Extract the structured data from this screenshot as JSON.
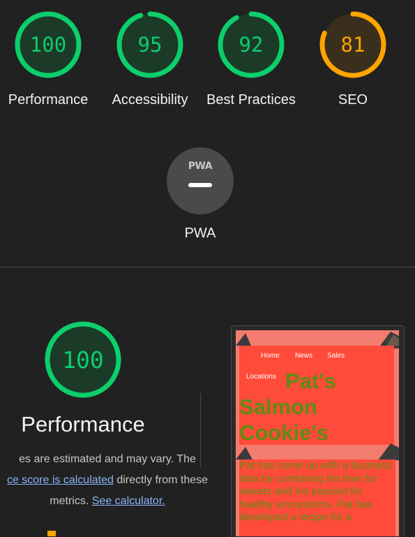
{
  "colors": {
    "pass": "#0cce6b",
    "pass_bg": "#1b3a28",
    "average": "#ffa400",
    "average_bg": "#3a2f1c"
  },
  "categories": [
    {
      "name": "Performance",
      "score": 100,
      "status": "pass"
    },
    {
      "name": "Accessibility",
      "score": 95,
      "status": "pass"
    },
    {
      "name": "Best Practices",
      "score": 92,
      "status": "pass"
    },
    {
      "name": "SEO",
      "score": 81,
      "status": "average"
    }
  ],
  "pwa": {
    "badge_text": "PWA",
    "label": "PWA"
  },
  "performance": {
    "score": 100,
    "title": "Performance",
    "desc_line1": "es are estimated and may vary. The",
    "desc_link1": "ce score is calculated",
    "desc_line2_rest": " directly from these",
    "desc_line3": "metrics. ",
    "desc_link2": "See calculator."
  },
  "screenshot": {
    "nav": [
      "Home",
      "News",
      "Sales",
      "Locations"
    ],
    "title": "Pat's Salmon Cookie's",
    "body": "Pat has come up with a business idea by combining his love for sweets and his passion for healthy ecosystems. Pat has developed a recipe for a"
  }
}
